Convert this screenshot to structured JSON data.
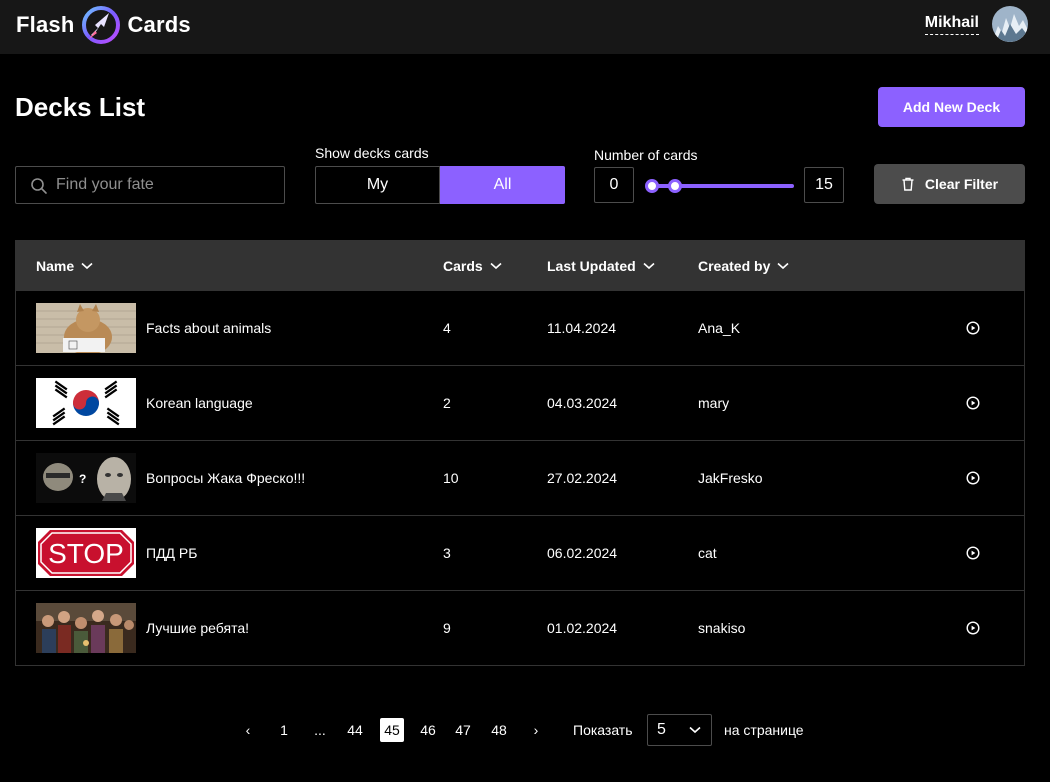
{
  "header": {
    "logo_left": "Flash",
    "logo_right": "Cards",
    "user_name": "Mikhail"
  },
  "page": {
    "title": "Decks List",
    "add_button": "Add New Deck"
  },
  "filters": {
    "search_placeholder": "Find your fate",
    "show_label": "Show decks cards",
    "tab_my": "My",
    "tab_all": "All",
    "active_tab": "All",
    "cards_label": "Number of cards",
    "min": "0",
    "max": "15",
    "clear_button": "Clear Filter"
  },
  "table": {
    "columns": [
      "Name",
      "Cards",
      "Last Updated",
      "Created by"
    ],
    "rows": [
      {
        "name": "Facts about animals",
        "cards": "4",
        "updated": "11.04.2024",
        "author": "Ana_K",
        "image": "cat-photo"
      },
      {
        "name": "Korean language",
        "cards": "2",
        "updated": "04.03.2024",
        "author": "mary",
        "image": "south-korea-flag"
      },
      {
        "name": "Вопросы Жака Фреско!!!",
        "cards": "10",
        "updated": "27.02.2024",
        "author": "JakFresko",
        "image": "faces-photo"
      },
      {
        "name": "ПДД РБ",
        "cards": "3",
        "updated": "06.02.2024",
        "author": "cat",
        "image": "stop-sign"
      },
      {
        "name": "Лучшие ребята!",
        "cards": "9",
        "updated": "01.02.2024",
        "author": "snakiso",
        "image": "painting"
      }
    ],
    "stop_sign_text": "STOP"
  },
  "pagination": {
    "prev": "‹",
    "next": "›",
    "pages": [
      "1",
      "...",
      "44",
      "45",
      "46",
      "47",
      "48"
    ],
    "current": "45",
    "show_label": "Показать",
    "per_page": "5",
    "per_page_suffix": "на странице"
  },
  "colors": {
    "accent": "#8c61ff",
    "header_bg": "#171717",
    "table_header_bg": "#333333",
    "border": "#4c4c4c"
  }
}
